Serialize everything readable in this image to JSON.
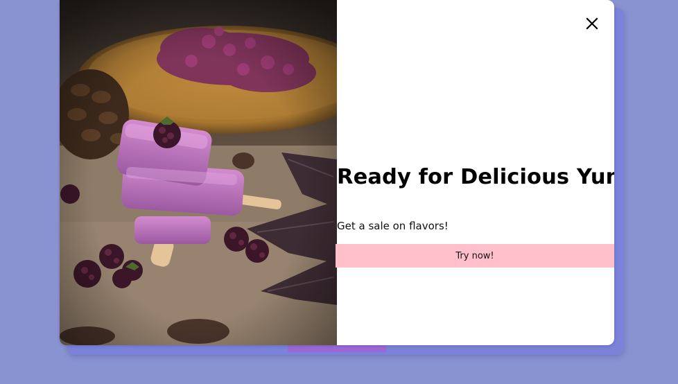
{
  "modal": {
    "headline": "Ready for Delicious Yum?",
    "subtext": "Get a sale on flavors!",
    "cta_label": "Try now!",
    "close_icon": "close-icon",
    "hero_image": "purple popsicles with blackberries"
  },
  "colors": {
    "page_background": "#8a93d1",
    "backdrop_card": "#7a82d9",
    "backdrop_bar": "#9b68d4",
    "modal_background": "#ffffff",
    "cta_background": "#ffc0cb",
    "headline_text": "#000000"
  }
}
